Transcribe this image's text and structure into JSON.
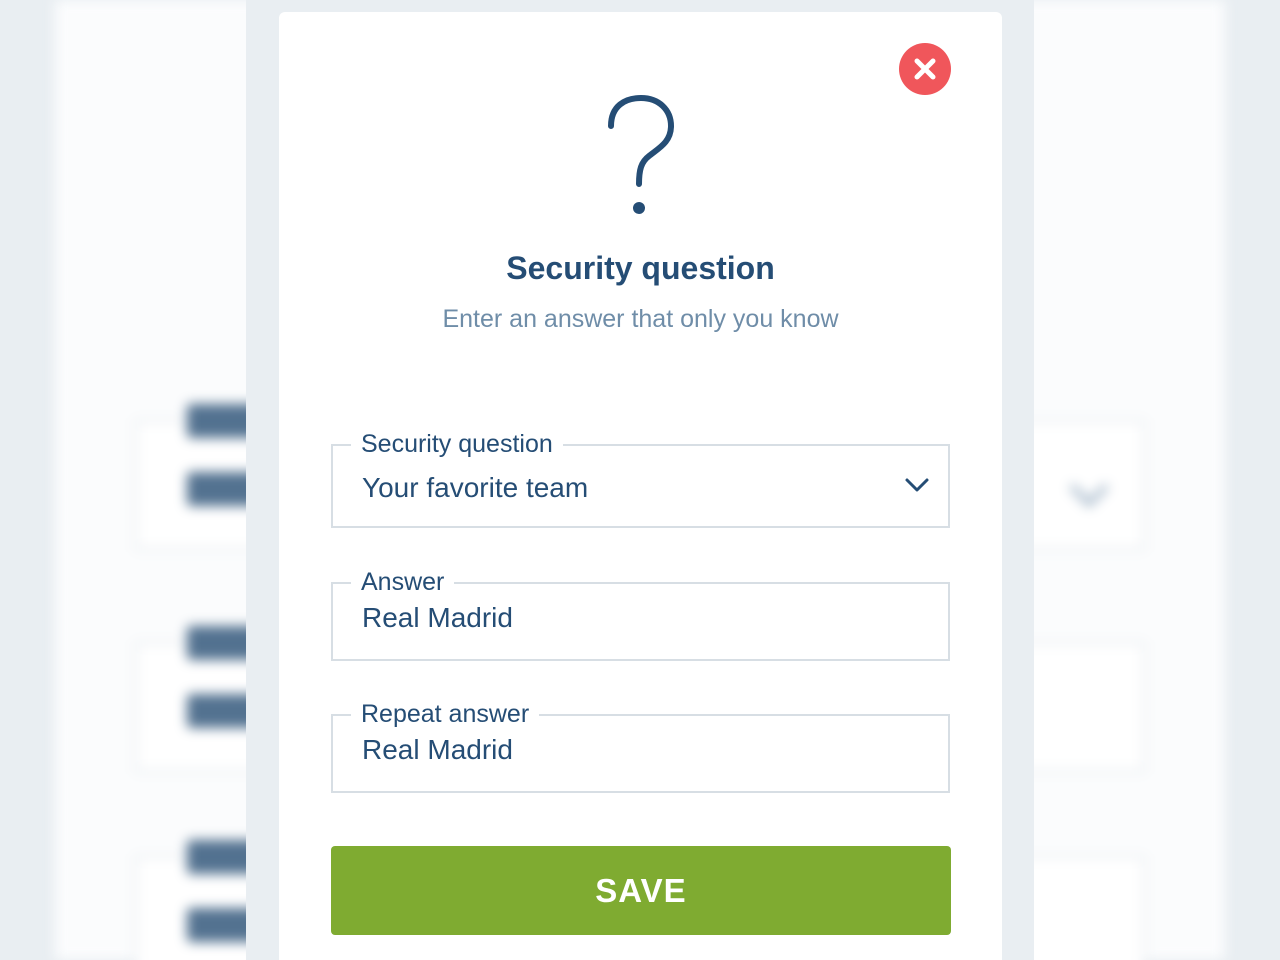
{
  "modal": {
    "close_icon": "close-x-icon",
    "header_icon": "question-mark-icon",
    "title": "Security question",
    "subtitle": "Enter an answer that only you know"
  },
  "form": {
    "question": {
      "label": "Security question",
      "value": "Your favorite team",
      "icon": "chevron-down-icon"
    },
    "answer": {
      "label": "Answer",
      "value": "Real Madrid"
    },
    "repeat_answer": {
      "label": "Repeat answer",
      "value": "Real Madrid"
    },
    "save_label": "SAVE"
  },
  "colors": {
    "primary_text": "#254d75",
    "secondary_text": "#6f8da8",
    "close_button": "#f0565b",
    "save_button": "#7fab31",
    "background": "#e9eef2"
  }
}
